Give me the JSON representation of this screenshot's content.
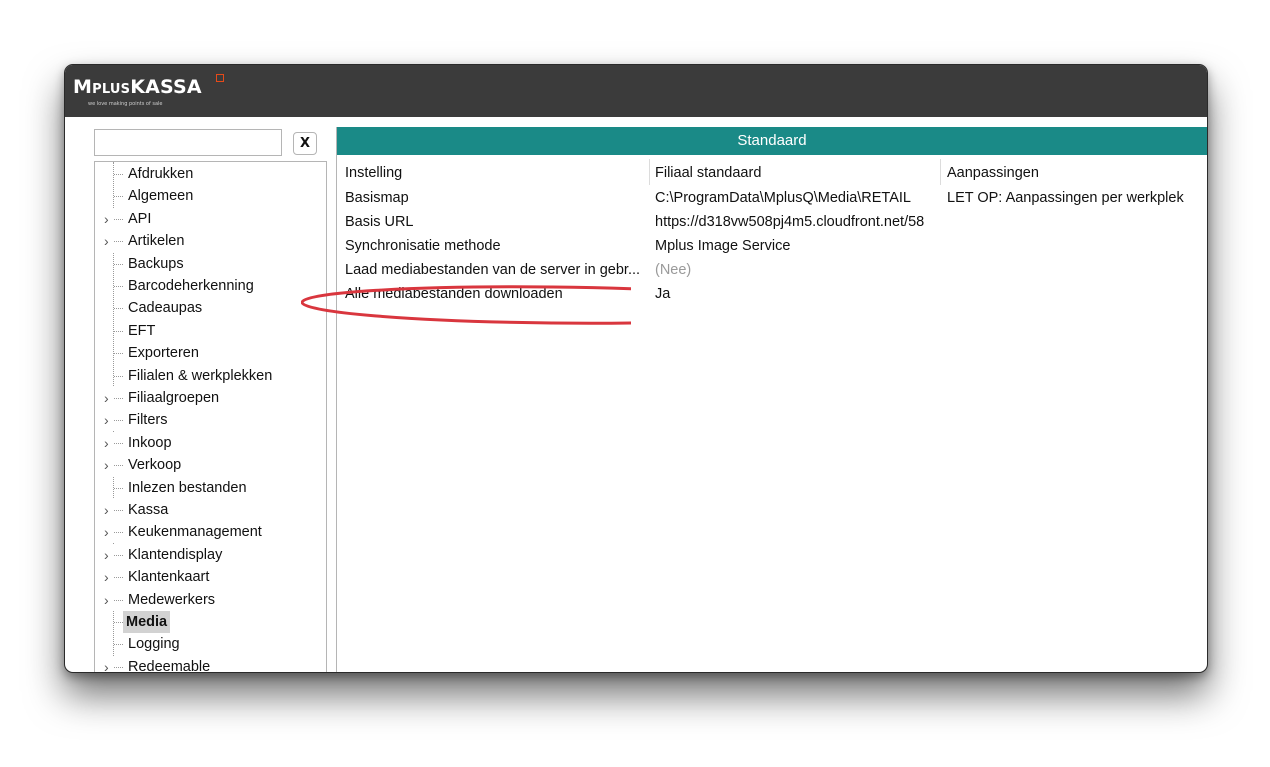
{
  "app": {
    "brand_main": "M",
    "brand_plus": "PLUS",
    "brand_kassa": "KASSA",
    "tagline": "we love making points of sale"
  },
  "search": {
    "value": "",
    "placeholder": "",
    "clear_label": "X"
  },
  "tree": {
    "items": [
      {
        "label": "Afdrukken",
        "expandable": false
      },
      {
        "label": "Algemeen",
        "expandable": false
      },
      {
        "label": "API",
        "expandable": true
      },
      {
        "label": "Artikelen",
        "expandable": true
      },
      {
        "label": "Backups",
        "expandable": false
      },
      {
        "label": "Barcodeherkenning",
        "expandable": false
      },
      {
        "label": "Cadeaupas",
        "expandable": false
      },
      {
        "label": "EFT",
        "expandable": false
      },
      {
        "label": "Exporteren",
        "expandable": false
      },
      {
        "label": "Filialen & werkplekken",
        "expandable": false
      },
      {
        "label": "Filiaalgroepen",
        "expandable": true
      },
      {
        "label": "Filters",
        "expandable": true
      },
      {
        "label": "Inkoop",
        "expandable": true
      },
      {
        "label": "Verkoop",
        "expandable": true
      },
      {
        "label": "Inlezen bestanden",
        "expandable": false
      },
      {
        "label": "Kassa",
        "expandable": true
      },
      {
        "label": "Keukenmanagement",
        "expandable": true
      },
      {
        "label": "Klantendisplay",
        "expandable": true
      },
      {
        "label": "Klantenkaart",
        "expandable": true
      },
      {
        "label": "Medewerkers",
        "expandable": true
      },
      {
        "label": "Media",
        "expandable": false,
        "selected": true
      },
      {
        "label": "Logging",
        "expandable": false
      },
      {
        "label": "Redeemable",
        "expandable": true
      }
    ]
  },
  "panel": {
    "title": "Standaard",
    "columns": [
      "Instelling",
      "Filiaal standaard",
      "Aanpassingen"
    ],
    "rows": [
      [
        "Basismap",
        "C:\\ProgramData\\MplusQ\\Media\\RETAIL",
        "LET OP: Aanpassingen per werkplek"
      ],
      [
        "Basis URL",
        "https://d318vw508pj4m5.cloudfront.net/58",
        ""
      ],
      [
        "Synchronisatie methode",
        "Mplus Image Service",
        ""
      ],
      [
        "Laad mediabestanden van de server in gebr...",
        "(Nee)",
        ""
      ],
      [
        "Alle mediabestanden downloaden",
        "Ja",
        ""
      ]
    ]
  },
  "colors": {
    "titlebar": "#3b3b3b",
    "header": "#1a8a87",
    "annotation": "#d9363e",
    "logo_mark": "#e64a19"
  }
}
